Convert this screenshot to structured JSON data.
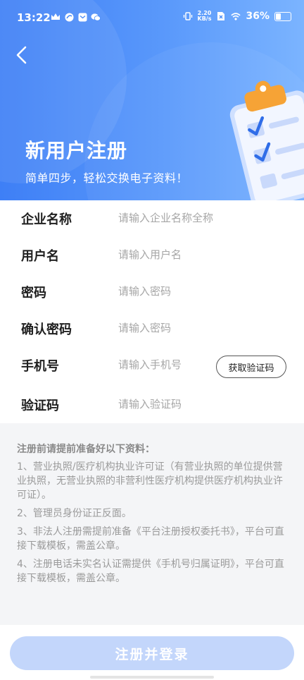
{
  "status_bar": {
    "time": "13:22",
    "net_speed_value": "2.20",
    "net_speed_unit": "KB/s",
    "battery": "36%",
    "battery_level": 0.36
  },
  "header": {
    "title": "新用户注册",
    "subtitle": "简单四步，轻松交换电子资料！",
    "accent_color": "#4a8cf8"
  },
  "form": {
    "company": {
      "label": "企业名称",
      "placeholder": "请输入企业名称全称"
    },
    "username": {
      "label": "用户名",
      "placeholder": "请输入用户名"
    },
    "password": {
      "label": "密码",
      "placeholder": "请输入密码"
    },
    "confirm_password": {
      "label": "确认密码",
      "placeholder": "请输入密码"
    },
    "phone": {
      "label": "手机号",
      "placeholder": "请输入手机号",
      "code_button": "获取验证码"
    },
    "code": {
      "label": "验证码",
      "placeholder": "请输入验证码"
    }
  },
  "notice": {
    "title": "注册前请提前准备好以下资料：",
    "items": [
      "1、营业执照/医疗机构执业许可证（有营业执照的单位提供营业执照，无营业执照的非营利性医疗机构提供医疗机构执业许可证）。",
      "2、管理员身份证正反面。",
      "3、非法人注册需提前准备《平台注册授权委托书》，平台可直接下载模板，需盖公章。",
      "4、注册电话未实名认证需提供《手机号归属证明》，平台可直接下载模板，需盖公章。"
    ]
  },
  "footer": {
    "submit_label": "注册并登录",
    "button_color": "#c3d6fb"
  }
}
